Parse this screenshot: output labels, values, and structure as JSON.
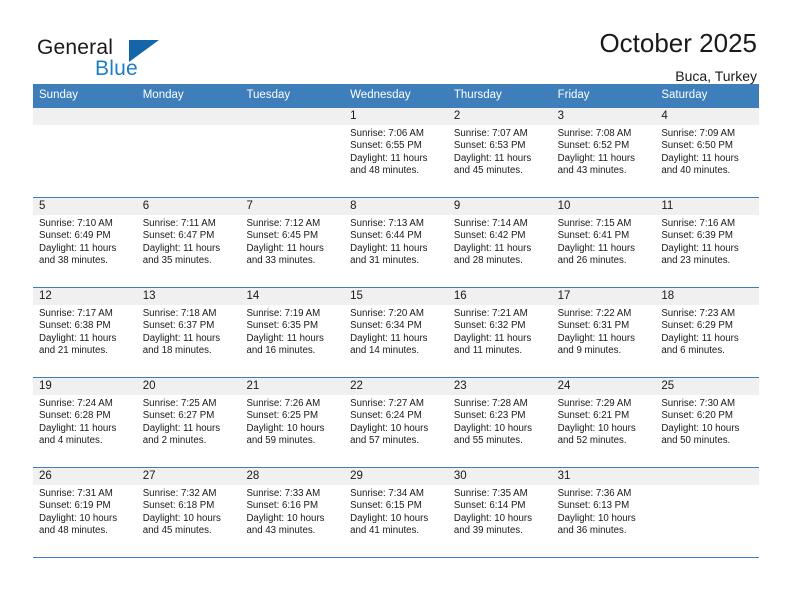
{
  "brand": {
    "name_part1": "General",
    "name_part2": "Blue",
    "triangle_color": "#1566a8",
    "blue_color": "#1d7fc4"
  },
  "header": {
    "title": "October 2025",
    "subtitle": "Buca, Turkey"
  },
  "theme": {
    "header_row_bg": "#3d7ebb",
    "daynum_band_bg": "#f0f0f0",
    "row_separator": "#3d7ebb",
    "text": "#1a1a1a"
  },
  "weekdays": [
    "Sunday",
    "Monday",
    "Tuesday",
    "Wednesday",
    "Thursday",
    "Friday",
    "Saturday"
  ],
  "labels": {
    "sunrise_prefix": "Sunrise:",
    "sunset_prefix": "Sunset:",
    "daylight_prefix": "Daylight:"
  },
  "weeks": [
    [
      {
        "day": "",
        "empty": true
      },
      {
        "day": "",
        "empty": true
      },
      {
        "day": "",
        "empty": true
      },
      {
        "day": "1",
        "sunrise": "Sunrise: 7:06 AM",
        "sunset": "Sunset: 6:55 PM",
        "daylight1": "Daylight: 11 hours",
        "daylight2": "and 48 minutes."
      },
      {
        "day": "2",
        "sunrise": "Sunrise: 7:07 AM",
        "sunset": "Sunset: 6:53 PM",
        "daylight1": "Daylight: 11 hours",
        "daylight2": "and 45 minutes."
      },
      {
        "day": "3",
        "sunrise": "Sunrise: 7:08 AM",
        "sunset": "Sunset: 6:52 PM",
        "daylight1": "Daylight: 11 hours",
        "daylight2": "and 43 minutes."
      },
      {
        "day": "4",
        "sunrise": "Sunrise: 7:09 AM",
        "sunset": "Sunset: 6:50 PM",
        "daylight1": "Daylight: 11 hours",
        "daylight2": "and 40 minutes."
      }
    ],
    [
      {
        "day": "5",
        "sunrise": "Sunrise: 7:10 AM",
        "sunset": "Sunset: 6:49 PM",
        "daylight1": "Daylight: 11 hours",
        "daylight2": "and 38 minutes."
      },
      {
        "day": "6",
        "sunrise": "Sunrise: 7:11 AM",
        "sunset": "Sunset: 6:47 PM",
        "daylight1": "Daylight: 11 hours",
        "daylight2": "and 35 minutes."
      },
      {
        "day": "7",
        "sunrise": "Sunrise: 7:12 AM",
        "sunset": "Sunset: 6:45 PM",
        "daylight1": "Daylight: 11 hours",
        "daylight2": "and 33 minutes."
      },
      {
        "day": "8",
        "sunrise": "Sunrise: 7:13 AM",
        "sunset": "Sunset: 6:44 PM",
        "daylight1": "Daylight: 11 hours",
        "daylight2": "and 31 minutes."
      },
      {
        "day": "9",
        "sunrise": "Sunrise: 7:14 AM",
        "sunset": "Sunset: 6:42 PM",
        "daylight1": "Daylight: 11 hours",
        "daylight2": "and 28 minutes."
      },
      {
        "day": "10",
        "sunrise": "Sunrise: 7:15 AM",
        "sunset": "Sunset: 6:41 PM",
        "daylight1": "Daylight: 11 hours",
        "daylight2": "and 26 minutes."
      },
      {
        "day": "11",
        "sunrise": "Sunrise: 7:16 AM",
        "sunset": "Sunset: 6:39 PM",
        "daylight1": "Daylight: 11 hours",
        "daylight2": "and 23 minutes."
      }
    ],
    [
      {
        "day": "12",
        "sunrise": "Sunrise: 7:17 AM",
        "sunset": "Sunset: 6:38 PM",
        "daylight1": "Daylight: 11 hours",
        "daylight2": "and 21 minutes."
      },
      {
        "day": "13",
        "sunrise": "Sunrise: 7:18 AM",
        "sunset": "Sunset: 6:37 PM",
        "daylight1": "Daylight: 11 hours",
        "daylight2": "and 18 minutes."
      },
      {
        "day": "14",
        "sunrise": "Sunrise: 7:19 AM",
        "sunset": "Sunset: 6:35 PM",
        "daylight1": "Daylight: 11 hours",
        "daylight2": "and 16 minutes."
      },
      {
        "day": "15",
        "sunrise": "Sunrise: 7:20 AM",
        "sunset": "Sunset: 6:34 PM",
        "daylight1": "Daylight: 11 hours",
        "daylight2": "and 14 minutes."
      },
      {
        "day": "16",
        "sunrise": "Sunrise: 7:21 AM",
        "sunset": "Sunset: 6:32 PM",
        "daylight1": "Daylight: 11 hours",
        "daylight2": "and 11 minutes."
      },
      {
        "day": "17",
        "sunrise": "Sunrise: 7:22 AM",
        "sunset": "Sunset: 6:31 PM",
        "daylight1": "Daylight: 11 hours",
        "daylight2": "and 9 minutes."
      },
      {
        "day": "18",
        "sunrise": "Sunrise: 7:23 AM",
        "sunset": "Sunset: 6:29 PM",
        "daylight1": "Daylight: 11 hours",
        "daylight2": "and 6 minutes."
      }
    ],
    [
      {
        "day": "19",
        "sunrise": "Sunrise: 7:24 AM",
        "sunset": "Sunset: 6:28 PM",
        "daylight1": "Daylight: 11 hours",
        "daylight2": "and 4 minutes."
      },
      {
        "day": "20",
        "sunrise": "Sunrise: 7:25 AM",
        "sunset": "Sunset: 6:27 PM",
        "daylight1": "Daylight: 11 hours",
        "daylight2": "and 2 minutes."
      },
      {
        "day": "21",
        "sunrise": "Sunrise: 7:26 AM",
        "sunset": "Sunset: 6:25 PM",
        "daylight1": "Daylight: 10 hours",
        "daylight2": "and 59 minutes."
      },
      {
        "day": "22",
        "sunrise": "Sunrise: 7:27 AM",
        "sunset": "Sunset: 6:24 PM",
        "daylight1": "Daylight: 10 hours",
        "daylight2": "and 57 minutes."
      },
      {
        "day": "23",
        "sunrise": "Sunrise: 7:28 AM",
        "sunset": "Sunset: 6:23 PM",
        "daylight1": "Daylight: 10 hours",
        "daylight2": "and 55 minutes."
      },
      {
        "day": "24",
        "sunrise": "Sunrise: 7:29 AM",
        "sunset": "Sunset: 6:21 PM",
        "daylight1": "Daylight: 10 hours",
        "daylight2": "and 52 minutes."
      },
      {
        "day": "25",
        "sunrise": "Sunrise: 7:30 AM",
        "sunset": "Sunset: 6:20 PM",
        "daylight1": "Daylight: 10 hours",
        "daylight2": "and 50 minutes."
      }
    ],
    [
      {
        "day": "26",
        "sunrise": "Sunrise: 7:31 AM",
        "sunset": "Sunset: 6:19 PM",
        "daylight1": "Daylight: 10 hours",
        "daylight2": "and 48 minutes."
      },
      {
        "day": "27",
        "sunrise": "Sunrise: 7:32 AM",
        "sunset": "Sunset: 6:18 PM",
        "daylight1": "Daylight: 10 hours",
        "daylight2": "and 45 minutes."
      },
      {
        "day": "28",
        "sunrise": "Sunrise: 7:33 AM",
        "sunset": "Sunset: 6:16 PM",
        "daylight1": "Daylight: 10 hours",
        "daylight2": "and 43 minutes."
      },
      {
        "day": "29",
        "sunrise": "Sunrise: 7:34 AM",
        "sunset": "Sunset: 6:15 PM",
        "daylight1": "Daylight: 10 hours",
        "daylight2": "and 41 minutes."
      },
      {
        "day": "30",
        "sunrise": "Sunrise: 7:35 AM",
        "sunset": "Sunset: 6:14 PM",
        "daylight1": "Daylight: 10 hours",
        "daylight2": "and 39 minutes."
      },
      {
        "day": "31",
        "sunrise": "Sunrise: 7:36 AM",
        "sunset": "Sunset: 6:13 PM",
        "daylight1": "Daylight: 10 hours",
        "daylight2": "and 36 minutes."
      },
      {
        "day": "",
        "empty": true
      }
    ]
  ]
}
